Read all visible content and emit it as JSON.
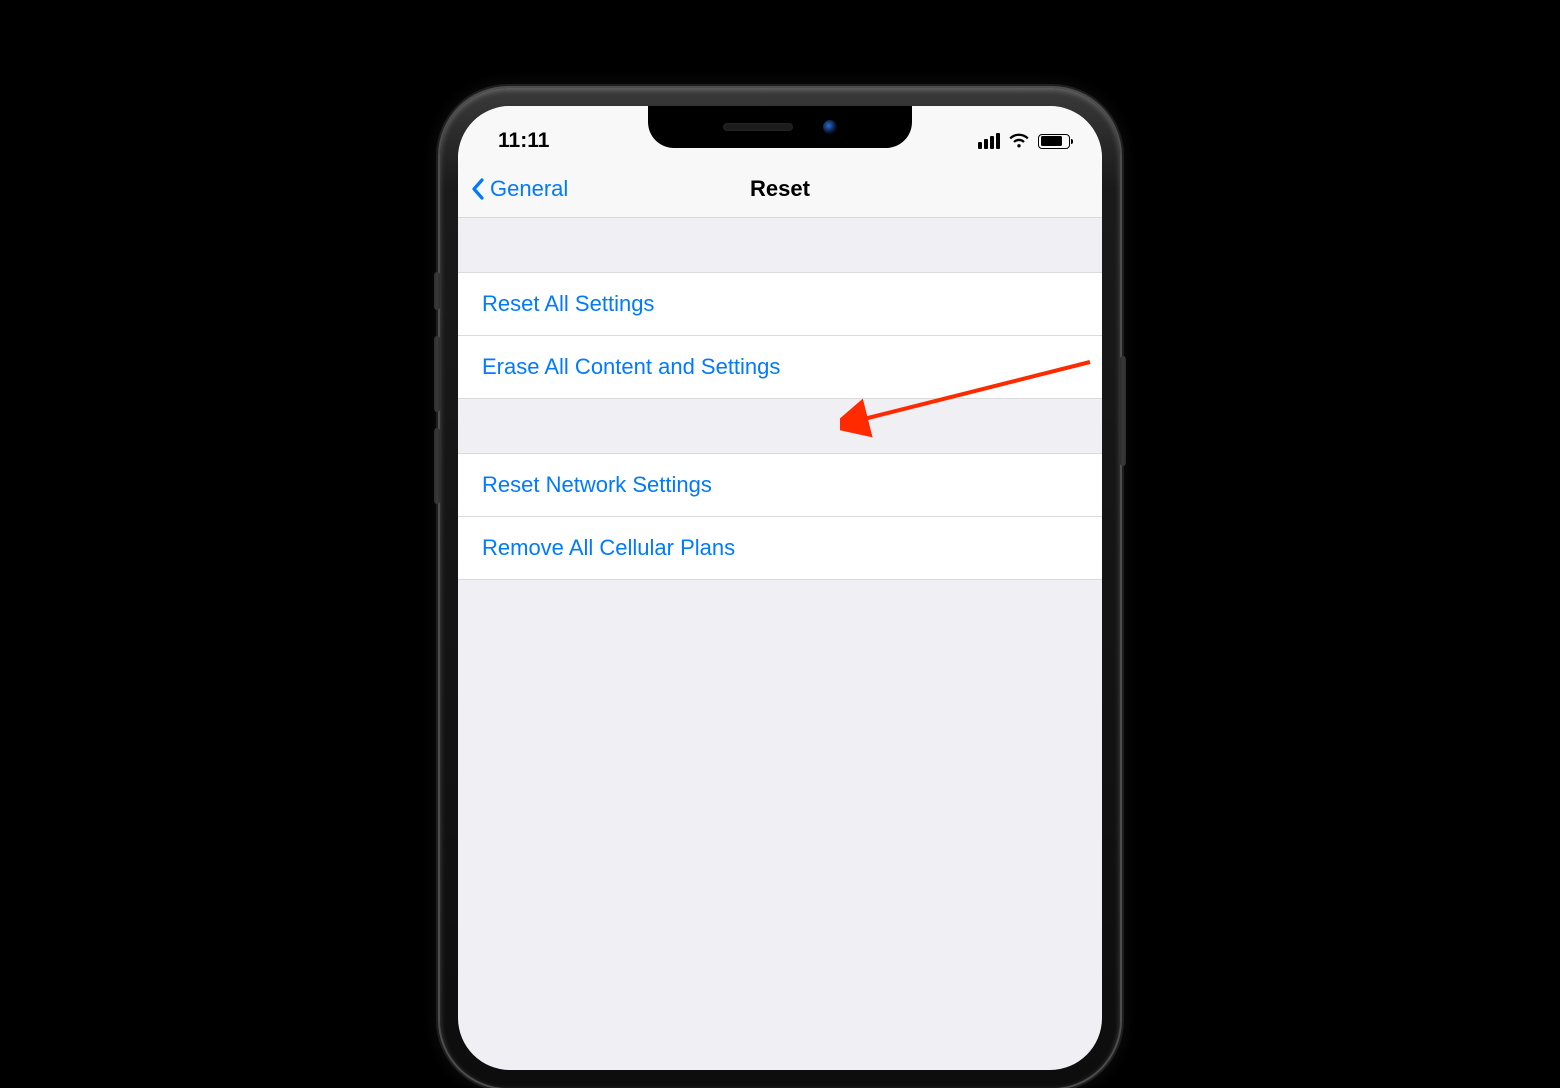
{
  "statusBar": {
    "time": "11:11"
  },
  "nav": {
    "back_label": "General",
    "title": "Reset"
  },
  "reset": {
    "group1": [
      {
        "label": "Reset All Settings"
      },
      {
        "label": "Erase All Content and Settings"
      }
    ],
    "group2": [
      {
        "label": "Reset Network Settings"
      },
      {
        "label": "Remove All Cellular Plans"
      }
    ]
  },
  "annotation": {
    "highlight_target": "erase-all-content"
  }
}
